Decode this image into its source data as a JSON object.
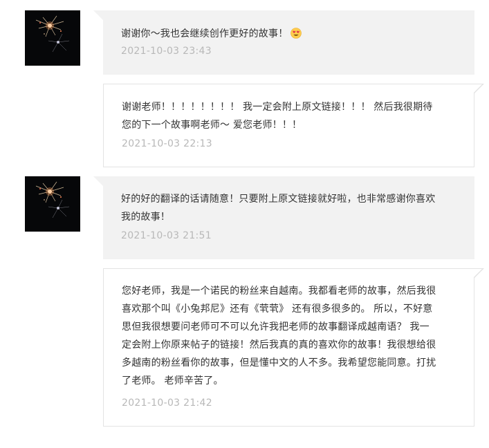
{
  "comments": [
    {
      "text": "谢谢你～我也会继续创作更好的故事！",
      "emoji": "smiling-face-with-heart-eyes-emoji",
      "time": "2021-10-03 23:43"
    },
    {
      "line1": "谢谢老师！！！！！！！！ 我一定会附上原文链接！！！  然后我很期待",
      "line2": "您的下一个故事啊老师～ 爱您老师！！！",
      "time": "2021-10-03 22:13"
    },
    {
      "line1": "好的好的翻译的话请随意！只要附上原文链接就好啦，也非常感谢你喜欢",
      "line2": "我的故事！",
      "time": "2021-10-03 21:51"
    },
    {
      "line1": "您好老师，我是一个诺民的粉丝来自越南。我都看老师的故事，然后我很",
      "line2": "喜欢那个叫《小兔邦尼》还有《茕茕》 还有很多很多的。 所以，不好意",
      "line3": "思但我很想要问老师可不可以允许我把老师的故事翻译成越南语？ 我一",
      "line4": "定会附上你原来帖子的链接！然后我真的真的喜欢你的故事！我很想给很",
      "line5": "多越南的粉丝看你的故事，但是懂中文的人不多。我希望您能同意。打扰",
      "line6": "了老师。 老师辛苦了。",
      "time": "2021-10-03 21:42"
    }
  ],
  "avatar_icon": "sparkler-avatar-icon",
  "colors": {
    "author_bubble": "#f2f2f2",
    "reader_bubble_border": "#e3e3e3",
    "text": "#333333",
    "timestamp": "#b8b8b8"
  }
}
